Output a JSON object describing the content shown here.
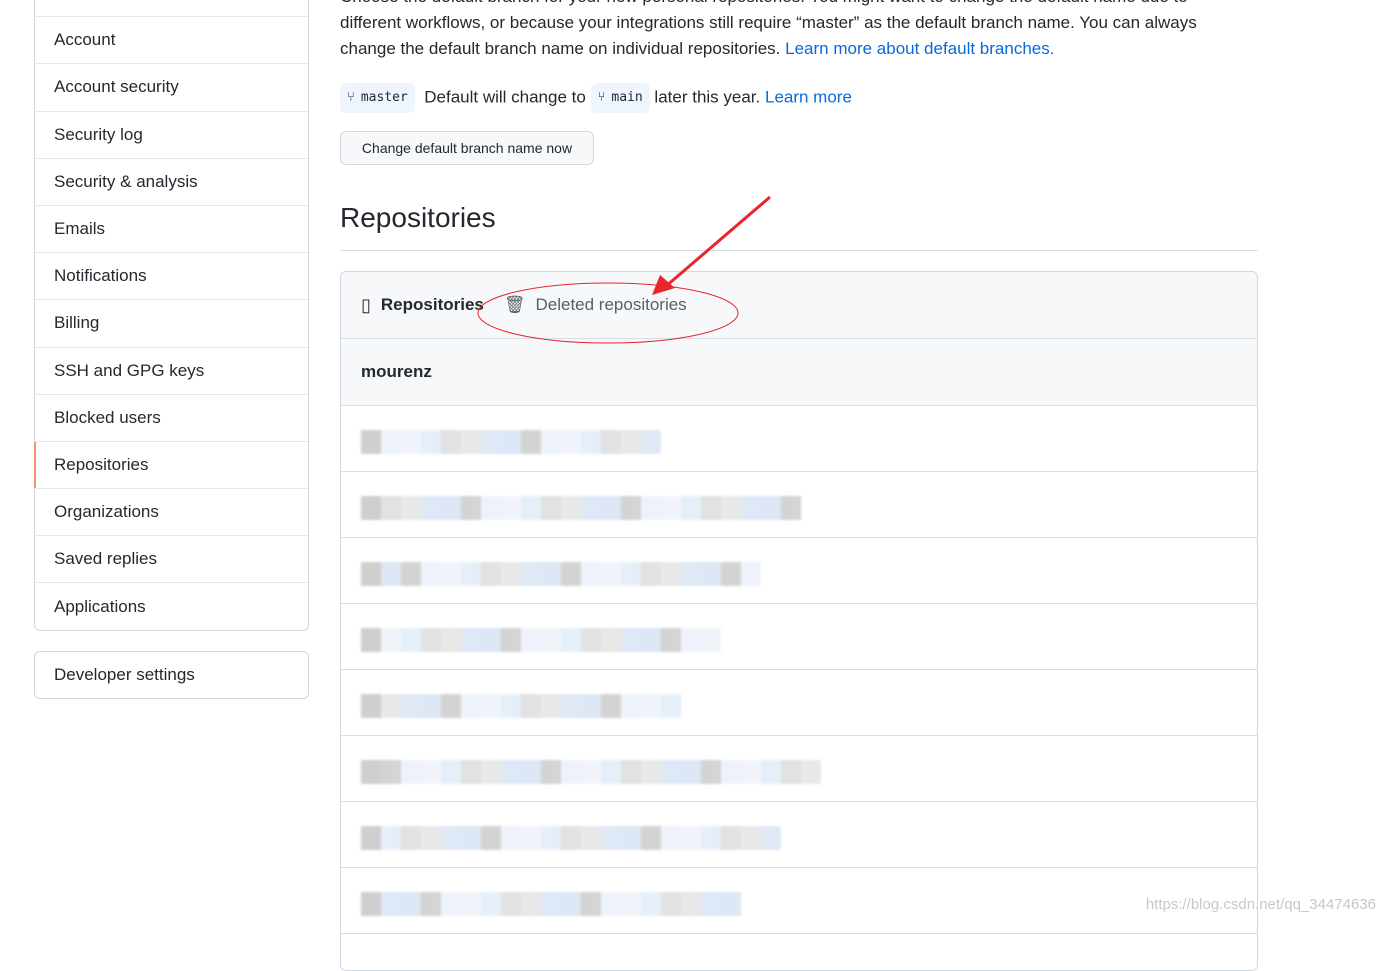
{
  "sidebar": {
    "items": [
      {
        "label": "Account"
      },
      {
        "label": "Account security"
      },
      {
        "label": "Security log"
      },
      {
        "label": "Security & analysis"
      },
      {
        "label": "Emails"
      },
      {
        "label": "Notifications"
      },
      {
        "label": "Billing"
      },
      {
        "label": "SSH and GPG keys"
      },
      {
        "label": "Blocked users"
      },
      {
        "label": "Repositories",
        "selected": true
      },
      {
        "label": "Organizations"
      },
      {
        "label": "Saved replies"
      },
      {
        "label": "Applications"
      }
    ],
    "developer": "Developer settings"
  },
  "intro": {
    "line0": "Choose the default branch for your new personal repositories. You might want to change the default name due to",
    "line1": "different workflows, or because your integrations still require “master” as the default branch name. You can always",
    "line2": "change the default branch name on individual repositories. ",
    "link": "Learn more about default branches."
  },
  "branch": {
    "current": "master",
    "text1": "Default will change to",
    "next": "main",
    "text2": "later this year.",
    "link": "Learn more"
  },
  "change_button": "Change default branch name now",
  "heading": "Repositories",
  "tabs": {
    "repos": "Repositories",
    "deleted": "Deleted repositories"
  },
  "owner": "mourenz",
  "annotation_color": "#e8262b",
  "watermark": "https://blog.csdn.net/qq_34474636"
}
